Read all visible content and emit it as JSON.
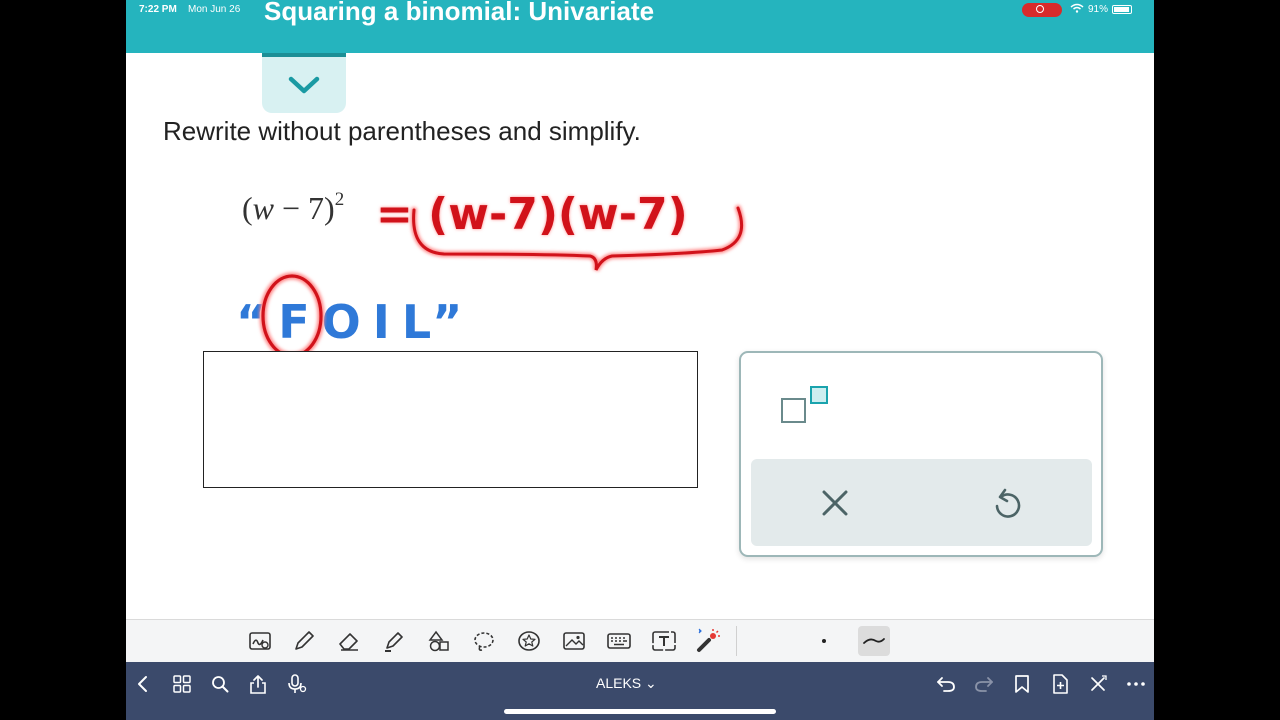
{
  "status_bar": {
    "time": "7:22 PM",
    "date": "Mon Jun 26",
    "battery_percent": "91%"
  },
  "header": {
    "title": "Squaring a binomial: Univariate"
  },
  "problem": {
    "instruction": "Rewrite without parentheses and simplify.",
    "expression_var": "w",
    "expression_rest": "− 7)",
    "expression_exponent": "2"
  },
  "handwriting": {
    "rewrite": "= (w-7)(w-7)",
    "method": "“FOIL”"
  },
  "answer": {
    "value": ""
  },
  "keypad": {
    "keys": [
      "exponent-key",
      "clear-key",
      "undo-key"
    ]
  },
  "annotation_tools": [
    "zoom-write",
    "pen",
    "eraser",
    "highlighter",
    "shapes",
    "lasso",
    "sticker",
    "image",
    "keyboard",
    "text",
    "laser"
  ],
  "bottom_nav": {
    "title": "ALEKS ⌄"
  },
  "colors": {
    "header": "#25b4be",
    "ink_red": "#d1121a",
    "ink_blue": "#2f79d8",
    "nav": "#3b4a6b",
    "cursor": "#3a37c9"
  }
}
